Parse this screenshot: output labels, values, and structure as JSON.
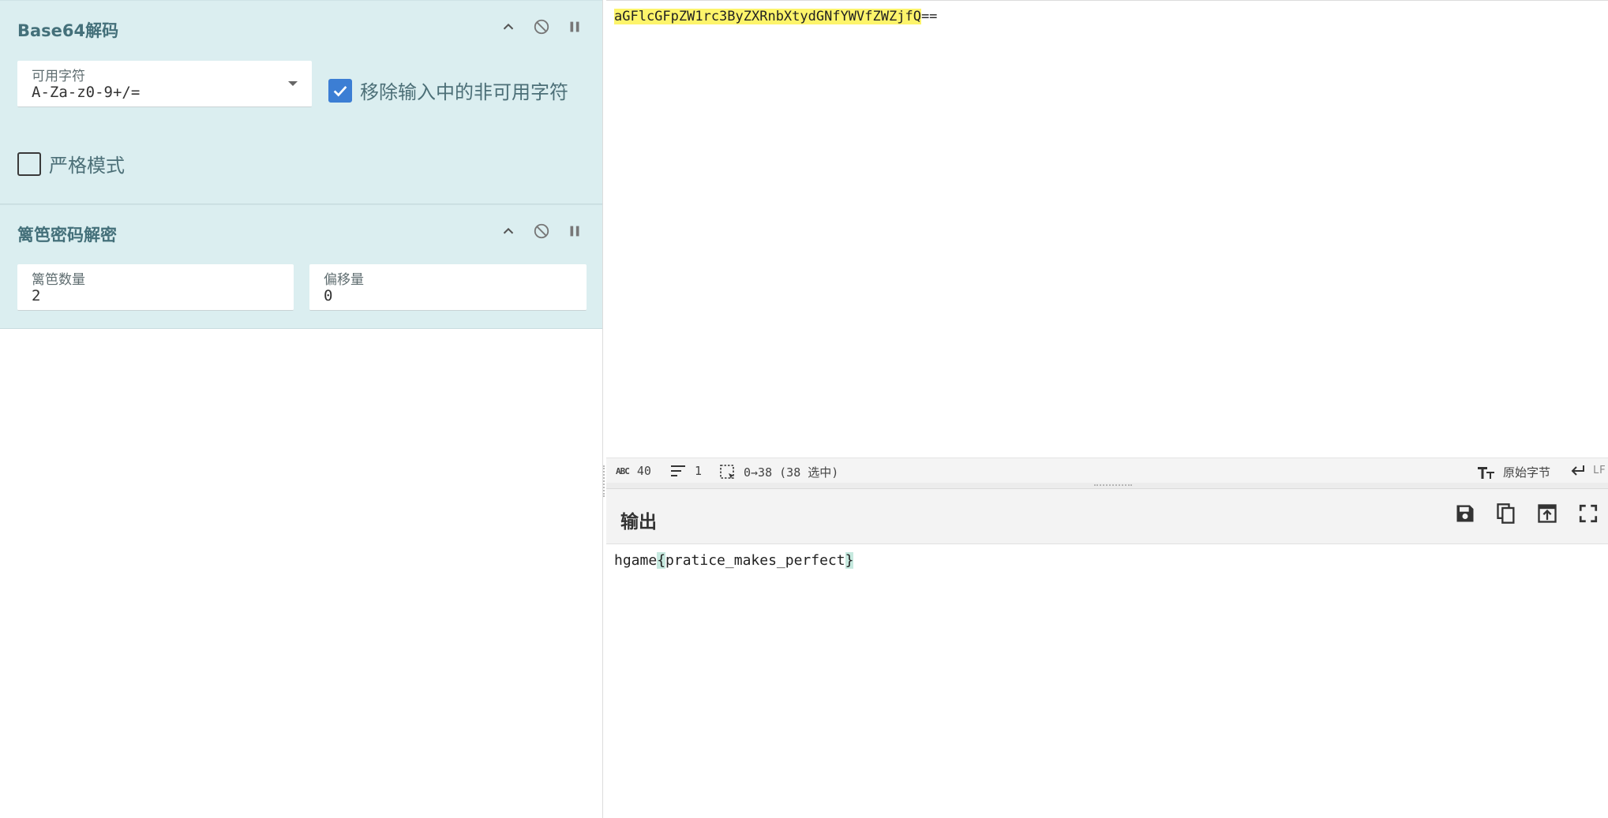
{
  "recipe": {
    "operations": [
      {
        "title": "Base64解码",
        "alphabet_label": "可用字符",
        "alphabet_value": "A-Za-z0-9+/=",
        "remove_nonalpha_label": "移除输入中的非可用字符",
        "remove_nonalpha_checked": true,
        "strict_label": "严格模式",
        "strict_checked": false
      },
      {
        "title": "篱笆密码解密",
        "rails_label": "篱笆数量",
        "rails_value": "2",
        "offset_label": "偏移量",
        "offset_value": "0"
      }
    ]
  },
  "input": {
    "highlighted": "aGFlcGFpZW1rc3ByZXRnbXtydGNfYWVfZWZjfQ",
    "rest": "=="
  },
  "status": {
    "length_icon": "ABC",
    "length": "40",
    "lines": "1",
    "selection": "0→38 (38 选中)",
    "encoding_label": "原始字节",
    "eol_label": "LF"
  },
  "output": {
    "title": "输出",
    "pre": "hgame",
    "open_brace": "{",
    "middle": "pratice_makes_perfect",
    "close_brace": "}"
  },
  "colors": {
    "recipe_bg": "#dbeef0",
    "title_color": "#44707a",
    "checkbox_on": "#3c7ed4",
    "input_highlight": "#fdf46b",
    "output_highlight": "#c6e9df"
  }
}
